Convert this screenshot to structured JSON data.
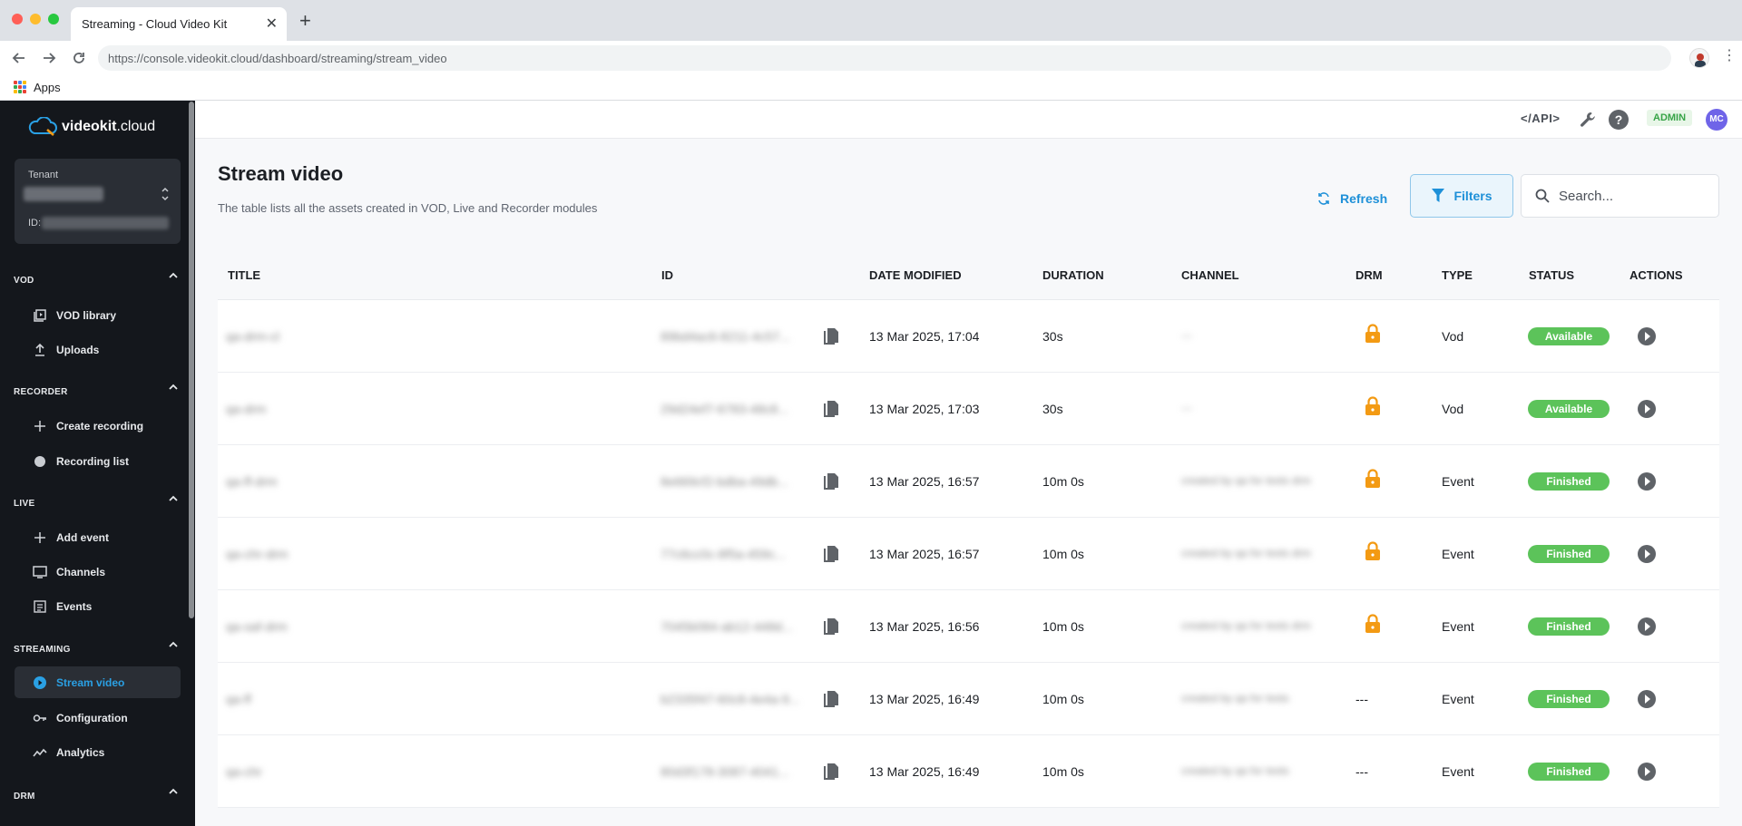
{
  "browser": {
    "tab_title": "Streaming - Cloud Video Kit",
    "tab_close": "✕",
    "new_tab": "+",
    "url": "https://console.videokit.cloud/dashboard/streaming/stream_video",
    "bookmarks_apps": "Apps"
  },
  "sidebar": {
    "logo_bold": "videokit",
    "logo_rest": ".cloud",
    "tenant_label": "Tenant",
    "tenant_id_label": "ID:",
    "sections": [
      {
        "title": "VOD",
        "items": [
          {
            "label": "VOD library",
            "icon": "library-icon"
          },
          {
            "label": "Uploads",
            "icon": "upload-icon"
          }
        ]
      },
      {
        "title": "RECORDER",
        "items": [
          {
            "label": "Create recording",
            "icon": "plus-icon"
          },
          {
            "label": "Recording list",
            "icon": "record-icon"
          }
        ]
      },
      {
        "title": "LIVE",
        "items": [
          {
            "label": "Add event",
            "icon": "plus-icon"
          },
          {
            "label": "Channels",
            "icon": "monitor-icon"
          },
          {
            "label": "Events",
            "icon": "list-icon"
          }
        ]
      },
      {
        "title": "STREAMING",
        "items": [
          {
            "label": "Stream video",
            "icon": "play-circle-icon",
            "active": true
          },
          {
            "label": "Configuration",
            "icon": "key-icon"
          },
          {
            "label": "Analytics",
            "icon": "chart-line-icon"
          }
        ]
      },
      {
        "title": "DRM",
        "items": []
      }
    ]
  },
  "topbar": {
    "api_label": "</API>",
    "help_label": "?",
    "role_badge": "ADMIN",
    "avatar_initials": "MC"
  },
  "page": {
    "title": "Stream video",
    "description": "The table lists all the assets created in VOD, Live and Recorder modules",
    "refresh_label": "Refresh",
    "filters_label": "Filters",
    "search_placeholder": "Search..."
  },
  "table": {
    "columns": [
      "TITLE",
      "ID",
      "DATE MODIFIED",
      "DURATION",
      "CHANNEL",
      "DRM",
      "TYPE",
      "STATUS",
      "ACTIONS"
    ],
    "rows": [
      {
        "title": "qa-drm-cl",
        "id": "89bd4ac6-8211-4c57...",
        "date": "13 Mar 2025, 17:04",
        "duration": "30s",
        "channel": "---",
        "drm": true,
        "type": "Vod",
        "status": "Available"
      },
      {
        "title": "qa-drm",
        "id": "29d24ef7-6783-48c8...",
        "date": "13 Mar 2025, 17:03",
        "duration": "30s",
        "channel": "---",
        "drm": true,
        "type": "Vod",
        "status": "Available"
      },
      {
        "title": "qa-ff-drm",
        "id": "8e669cf2-bdba-49db...",
        "date": "13 Mar 2025, 16:57",
        "duration": "10m 0s",
        "channel": "created by qa for tests drm",
        "drm": true,
        "type": "Event",
        "status": "Finished"
      },
      {
        "title": "qa-chr-drm",
        "id": "77c6cc0c-8f5a-459c...",
        "date": "13 Mar 2025, 16:57",
        "duration": "10m 0s",
        "channel": "created by qa for tests drm",
        "drm": true,
        "type": "Event",
        "status": "Finished"
      },
      {
        "title": "qa-saf-drm",
        "id": "7045b084-ab12-448d...",
        "date": "13 Mar 2025, 16:56",
        "duration": "10m 0s",
        "channel": "created by qa for tests drm",
        "drm": true,
        "type": "Event",
        "status": "Finished"
      },
      {
        "title": "qa-ff",
        "id": "b2335f47-60c8-4e4a-9...",
        "date": "13 Mar 2025, 16:49",
        "duration": "10m 0s",
        "channel": "created by qa for tests",
        "drm": false,
        "drm_text": "---",
        "type": "Event",
        "status": "Finished"
      },
      {
        "title": "qa-chr",
        "id": "80d3f178-3087-4041...",
        "date": "13 Mar 2025, 16:49",
        "duration": "10m 0s",
        "channel": "created by qa for tests",
        "drm": false,
        "drm_text": "---",
        "type": "Event",
        "status": "Finished"
      }
    ]
  },
  "colors": {
    "sidebar_bg": "#14171c",
    "accent": "#1e90d8",
    "status_green": "#5cc35a",
    "lock_orange": "#f39a13"
  }
}
